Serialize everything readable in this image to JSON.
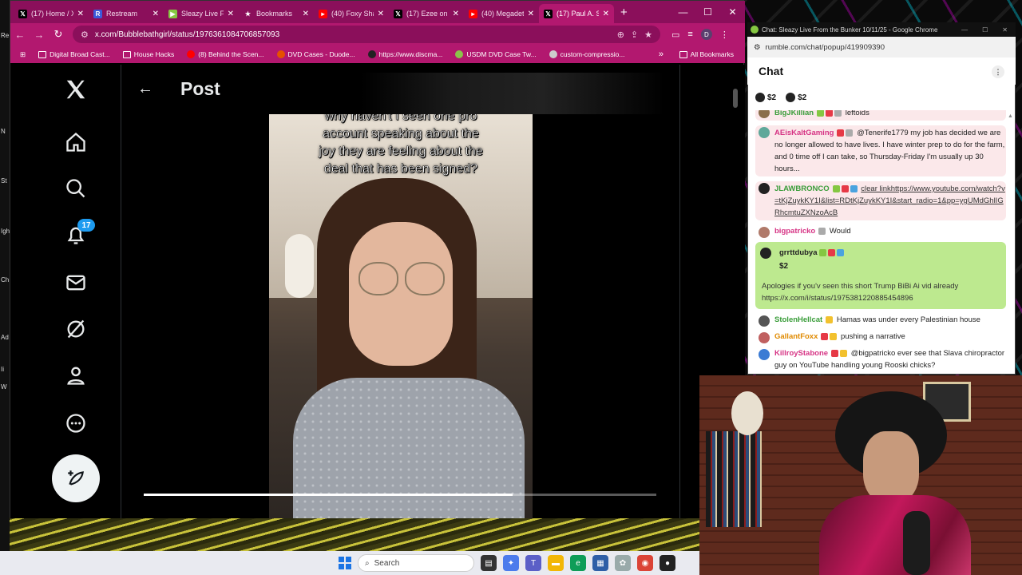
{
  "left_strip": [
    "Re",
    "N",
    "St",
    "Igh",
    "Ch",
    "Ad",
    "Ii",
    "W"
  ],
  "browser": {
    "tabs": [
      {
        "label": "(17) Home / X",
        "icon": "x-logo-icon",
        "color": "#000000",
        "active": false
      },
      {
        "label": "Restream",
        "icon": "restream-icon",
        "color": "#3b5bdb",
        "active": false
      },
      {
        "label": "Sleazy Live Fr",
        "icon": "rumble-icon",
        "color": "#85c742",
        "active": false
      },
      {
        "label": "Bookmarks",
        "icon": "star-icon",
        "color": "#ffffff",
        "active": false
      },
      {
        "label": "(40) Foxy Sha",
        "icon": "youtube-icon",
        "color": "#ff0000",
        "active": false
      },
      {
        "label": "(17) Ezee on",
        "icon": "x-logo-icon",
        "color": "#000000",
        "active": false
      },
      {
        "label": "(40) Megadet",
        "icon": "youtube-icon",
        "color": "#ff0000",
        "active": false
      },
      {
        "label": "(17) Paul A. S",
        "icon": "x-logo-icon",
        "color": "#000000",
        "active": true
      }
    ],
    "url": "x.com/Bubblebathgirl/status/1976361084706857093",
    "bookmarks": [
      "Digital Broad Cast...",
      "House Hacks",
      "(8) Behind the Scen...",
      "DVD Cases - Duode...",
      "https://www.discma...",
      "USDM DVD Case Tw...",
      "custom-compressio..."
    ],
    "all_bookmarks": "All Bookmarks"
  },
  "x_page": {
    "header_title": "Post",
    "notification_count": "17",
    "nav_icons": [
      "x-logo-icon",
      "home-icon",
      "search-icon",
      "bell-icon",
      "mail-icon",
      "grok-icon",
      "profile-icon",
      "more-icon"
    ],
    "video_caption": [
      "why haven't I seen one pro",
      "account speaking about the",
      "joy they are feeling about the",
      "deal that has been signed?"
    ],
    "progress": 0.72
  },
  "chat": {
    "window_title": "Chat: Sleazy Live From the Bunker 10/11/25 - Google Chrome",
    "url": "rumble.com/chat/popup/419909390",
    "header": "Chat",
    "tips": [
      {
        "amount": "$2"
      },
      {
        "amount": "$2"
      }
    ],
    "messages": [
      {
        "user": "BigJKillian",
        "text": "leftoids",
        "color": "#3a9d3a",
        "highlight": true
      },
      {
        "user": "AEisKaltGaming",
        "text": "@Tenerife1779 my job has decided we are no longer allowed to have lives. I have winter prep to do for the farm, and 0 time off I can take, so Thursday-Friday I'm usually up 30 hours...",
        "color": "#d63384",
        "highlight": true
      },
      {
        "user": "JLAWBRONCO",
        "text": "clear linkhttps://www.youtube.com/watch?v=tKjZuykKY1I&list=RDtKjZuykKY1I&start_radio=1&pp=ygUMdGhlIGRhcmtuZXNzoAcB",
        "color": "#3a9d3a",
        "highlight": true
      },
      {
        "user": "bigpatricko",
        "text": "Would",
        "color": "#d63384",
        "highlight": false
      }
    ],
    "rant": {
      "user": "grrttdubya",
      "amount": "$2",
      "text": "Apologies if you'v seen this short Trump BiBi Ai vid already https://x.com/i/status/1975381220885454896"
    },
    "messages2": [
      {
        "user": "StolenHellcat",
        "text": "Hamas was under every Palestinian house",
        "color": "#3a9d3a"
      },
      {
        "user": "GallantFoxx",
        "text": "pushing a narrative",
        "color": "#e08a00"
      },
      {
        "user": "KillroyStabone",
        "text": "@bigpatricko ever see that Slava chiropractor guy on YouTube handling young Rooski chicks?",
        "color": "#d63384"
      }
    ]
  },
  "taskbar": {
    "search_placeholder": "Search"
  }
}
